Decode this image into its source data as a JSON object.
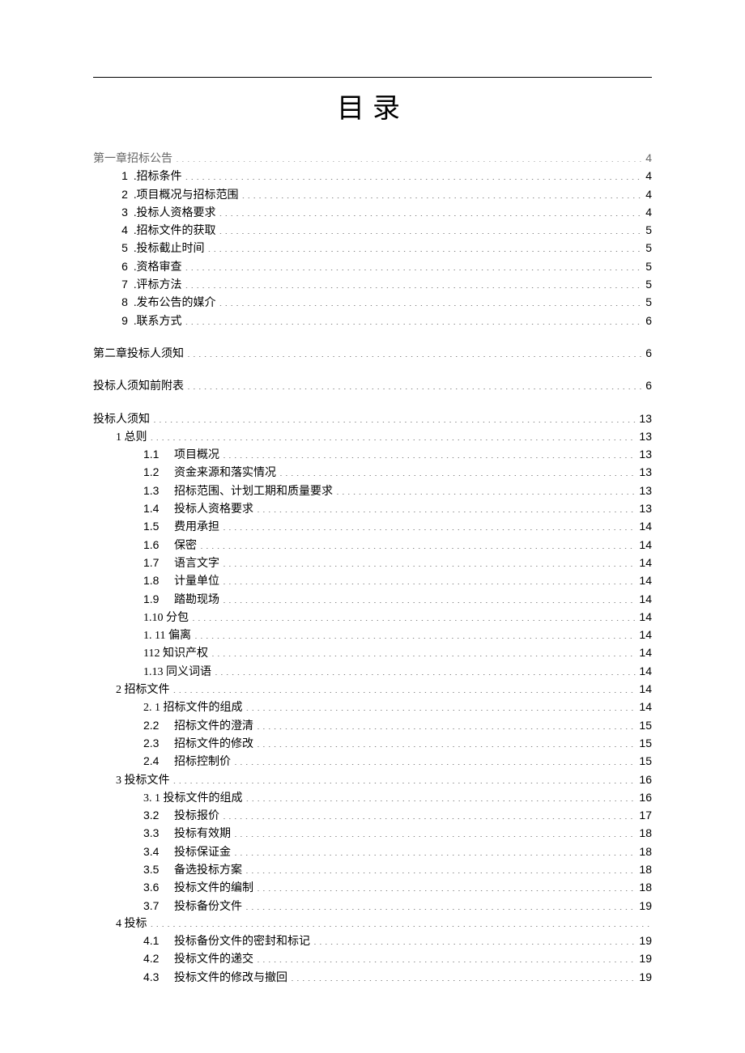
{
  "title": "目录",
  "toc": [
    {
      "cls": "lvl0 grey",
      "num": "",
      "label": "第一章招标公告",
      "page": "4"
    },
    {
      "cls": "lvl1",
      "num": "1",
      "label": ".招标条件",
      "page": "4"
    },
    {
      "cls": "lvl1",
      "num": "2",
      "label": ".项目概况与招标范围",
      "page": "4"
    },
    {
      "cls": "lvl1",
      "num": "3",
      "label": ".投标人资格要求",
      "page": "4"
    },
    {
      "cls": "lvl1",
      "num": "4",
      "label": ".招标文件的获取",
      "page": "5"
    },
    {
      "cls": "lvl1",
      "num": "5",
      "label": ".投标截止时间",
      "page": "5"
    },
    {
      "cls": "lvl1",
      "num": "6",
      "label": ".资格审查",
      "page": "5"
    },
    {
      "cls": "lvl1",
      "num": "7",
      "label": ".评标方法",
      "page": "5"
    },
    {
      "cls": "lvl1",
      "num": "8",
      "label": ".发布公告的媒介",
      "page": "5"
    },
    {
      "cls": "lvl1",
      "num": "9",
      "label": ".联系方式",
      "page": "6"
    },
    {
      "cls": "gap-md"
    },
    {
      "cls": "lvl0",
      "num": "",
      "label": "第二章投标人须知",
      "page": "6"
    },
    {
      "cls": "gap-md"
    },
    {
      "cls": "lvl0",
      "num": "",
      "label": "投标人须知前附表",
      "page": "6"
    },
    {
      "cls": "gap-md"
    },
    {
      "cls": "lvl0",
      "num": "",
      "label": "投标人须知",
      "page": "13"
    },
    {
      "cls": "lvl1",
      "num": "",
      "label": "1 总则",
      "page": "13"
    },
    {
      "cls": "lvl2",
      "num": "1.1",
      "label": "项目概况",
      "page": "13"
    },
    {
      "cls": "lvl2",
      "num": "1.2",
      "label": "资金来源和落实情况",
      "page": "13"
    },
    {
      "cls": "lvl2",
      "num": "1.3",
      "label": "招标范围、计划工期和质量要求",
      "page": "13"
    },
    {
      "cls": "lvl2",
      "num": "1.4",
      "label": "投标人资格要求",
      "page": "13"
    },
    {
      "cls": "lvl2",
      "num": "1.5",
      "label": "费用承担",
      "page": "14"
    },
    {
      "cls": "lvl2",
      "num": "1.6",
      "label": "保密",
      "page": "14"
    },
    {
      "cls": "lvl2",
      "num": "1.7",
      "label": "语言文字",
      "page": "14"
    },
    {
      "cls": "lvl2",
      "num": "1.8",
      "label": "计量单位",
      "page": "14"
    },
    {
      "cls": "lvl2",
      "num": "1.9",
      "label": "踏勘现场",
      "page": "14"
    },
    {
      "cls": "lvl2",
      "num": "",
      "label": "1.10 分包",
      "page": "14"
    },
    {
      "cls": "lvl2",
      "num": "",
      "label": "1.   11 偏离",
      "page": "14"
    },
    {
      "cls": "lvl2",
      "num": "",
      "label": "112 知识产权",
      "page": "14"
    },
    {
      "cls": "lvl2",
      "num": "",
      "label": "1.13 同义词语",
      "page": "14"
    },
    {
      "cls": "lvl1",
      "num": "",
      "label": "2 招标文件",
      "page": "14"
    },
    {
      "cls": "lvl2",
      "num": "",
      "label": "2.   1 招标文件的组成",
      "page": "14"
    },
    {
      "cls": "lvl2",
      "num": "2.2",
      "label": "招标文件的澄清",
      "page": "15"
    },
    {
      "cls": "lvl2",
      "num": "2.3",
      "label": "招标文件的修改",
      "page": "15"
    },
    {
      "cls": "lvl2",
      "num": "2.4",
      "label": "招标控制价",
      "page": "15"
    },
    {
      "cls": "lvl1",
      "num": "",
      "label": "3 投标文件",
      "page": "16"
    },
    {
      "cls": "lvl2",
      "num": "",
      "label": "3.   1 投标文件的组成",
      "page": "16"
    },
    {
      "cls": "lvl2",
      "num": "3.2",
      "label": "投标报价",
      "page": "17"
    },
    {
      "cls": "lvl2",
      "num": "3.3",
      "label": "投标有效期",
      "page": "18"
    },
    {
      "cls": "lvl2",
      "num": "3.4",
      "label": "投标保证金",
      "page": "18"
    },
    {
      "cls": "lvl2",
      "num": "3.5",
      "label": "备选投标方案",
      "page": "18"
    },
    {
      "cls": "lvl2",
      "num": "3.6",
      "label": "投标文件的编制",
      "page": "18"
    },
    {
      "cls": "lvl2",
      "num": "3.7",
      "label": "投标备份文件",
      "page": "19"
    },
    {
      "cls": "lvl1",
      "num": "",
      "label": "4 投标",
      "page": "",
      "nopage": true
    },
    {
      "cls": "lvl2",
      "num": "4.1",
      "label": "投标备份文件的密封和标记",
      "page": "19"
    },
    {
      "cls": "lvl2",
      "num": "4.2",
      "label": "投标文件的递交",
      "page": "19"
    },
    {
      "cls": "lvl2",
      "num": "4.3",
      "label": "投标文件的修改与撤回",
      "page": "19"
    }
  ]
}
